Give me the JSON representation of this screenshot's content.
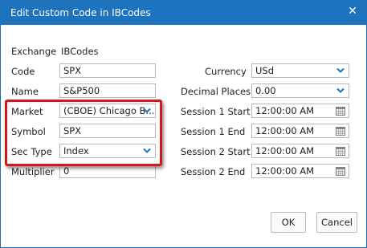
{
  "window": {
    "title": "Edit Custom Code in IBCodes"
  },
  "left": {
    "exchange": {
      "label": "Exchange",
      "value": "IBCodes"
    },
    "code": {
      "label": "Code",
      "value": "SPX"
    },
    "name": {
      "label": "Name",
      "value": "S&P500"
    },
    "market": {
      "label": "Market",
      "value": "(CBOE) Chicago B..."
    },
    "symbol": {
      "label": "Symbol",
      "value": "SPX"
    },
    "sec_type": {
      "label": "Sec Type",
      "value": "Index"
    },
    "multiplier": {
      "label": "Multiplier",
      "value": "0"
    }
  },
  "right": {
    "currency": {
      "label": "Currency",
      "value": "USd"
    },
    "decimal_places": {
      "label": "Decimal Places",
      "value": "0.00"
    },
    "session1_start": {
      "label": "Session 1 Start",
      "value": "12:00:00 AM"
    },
    "session1_end": {
      "label": "Session 1 End",
      "value": "12:00:00 AM"
    },
    "session2_start": {
      "label": "Session 2 Start",
      "value": "12:00:00 AM"
    },
    "session2_end": {
      "label": "Session 2 End",
      "value": "12:00:00 AM"
    }
  },
  "buttons": {
    "ok": "OK",
    "cancel": "Cancel"
  },
  "colors": {
    "titlebar": "#1e73be",
    "highlight": "#d8151c",
    "chevron": "#1e73be"
  },
  "icons": {
    "close": "close-icon",
    "dropdown": "chevron-down-icon",
    "calendar": "calendar-icon"
  }
}
